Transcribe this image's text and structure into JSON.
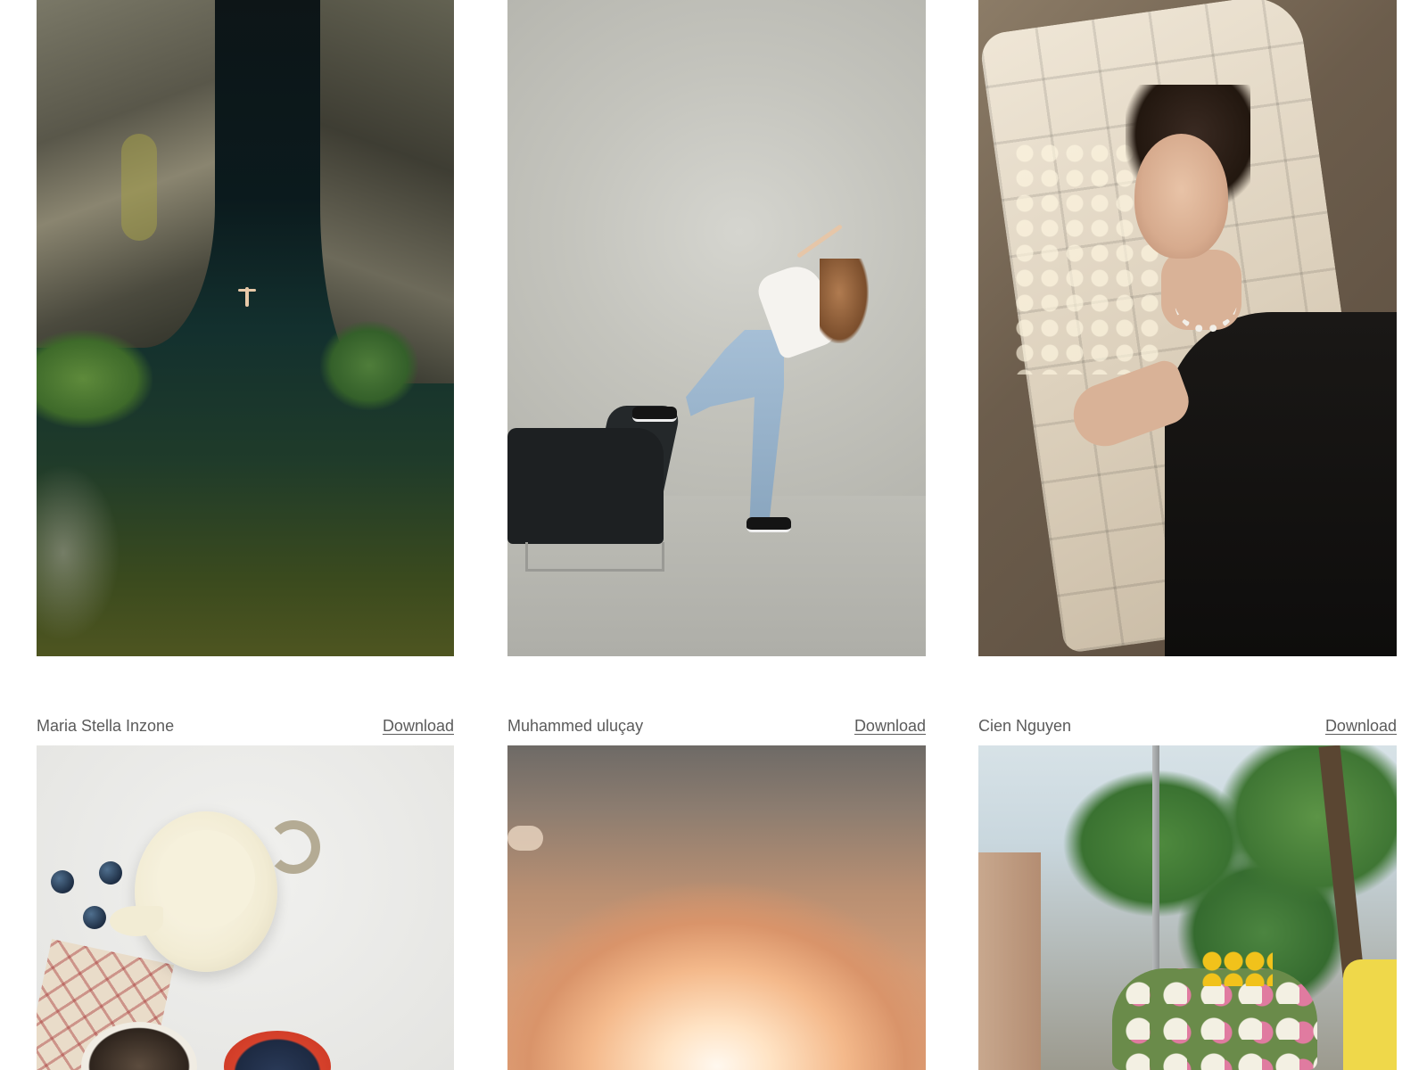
{
  "gallery": {
    "row1": [
      {
        "photo_alt": "Aerial view of a person floating in a river between rocky cliffs"
      },
      {
        "photo_alt": "Dancer in jeans posing with one foot on a black armchair"
      },
      {
        "photo_alt": "Woman in a black dress leaning on a cream tufted sofa"
      }
    ],
    "row2": [
      {
        "author": "Maria Stella Inzone",
        "download_label": "Download",
        "photo_alt": "Milk jug with blueberries on a white table"
      },
      {
        "author": "Muhammed uluçay",
        "download_label": "Download",
        "photo_alt": "Orange sunset sky"
      },
      {
        "author": "Cien Nguyen",
        "download_label": "Download",
        "photo_alt": "Street with trees and a flower vendor bicycle"
      }
    ]
  }
}
